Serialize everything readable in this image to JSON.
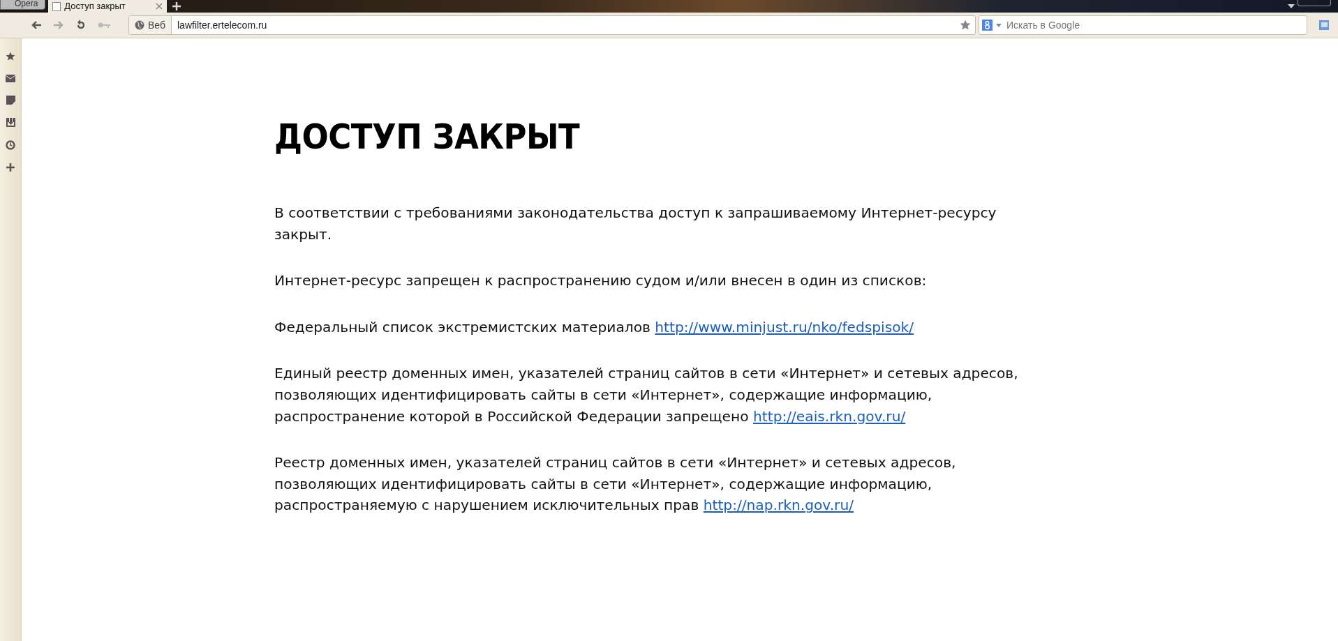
{
  "browser": {
    "menu_button": "Opera",
    "tab": {
      "title": "Доступ закрыт",
      "selected": true
    },
    "address_bar": {
      "badge": "Веб",
      "url": "lawfilter.ertelecom.ru"
    },
    "search": {
      "placeholder": "Искать в Google"
    }
  },
  "page": {
    "heading": "ДОСТУП ЗАКРЫТ",
    "paragraphs": [
      {
        "text": "В соответствии с требованиями законодательства доступ к запрашиваемому Интернет-ресурсу закрыт."
      },
      {
        "text": "Интернет-ресурс запрещен к распространению судом и/или внесен в один из списков:"
      },
      {
        "text": "Федеральный список экстремистских материалов",
        "link": "http://www.minjust.ru/nko/fedspisok/"
      },
      {
        "text": "Единый реестр доменных имен, указателей страниц сайтов в сети «Интернет» и сетевых адресов, позволяющих идентифицировать сайты в сети «Интернет», содержащие информацию, распространение которой в Российской Федерации запрещено",
        "link": "http://eais.rkn.gov.ru/"
      },
      {
        "text": "Реестр доменных имен, указателей страниц сайтов в сети «Интернет» и сетевых адресов, позволяющих идентифицировать сайты в сети «Интернет», содержащие информацию, распространяемую с нарушением исключительных прав",
        "link": "http://nap.rkn.gov.ru/"
      }
    ]
  }
}
